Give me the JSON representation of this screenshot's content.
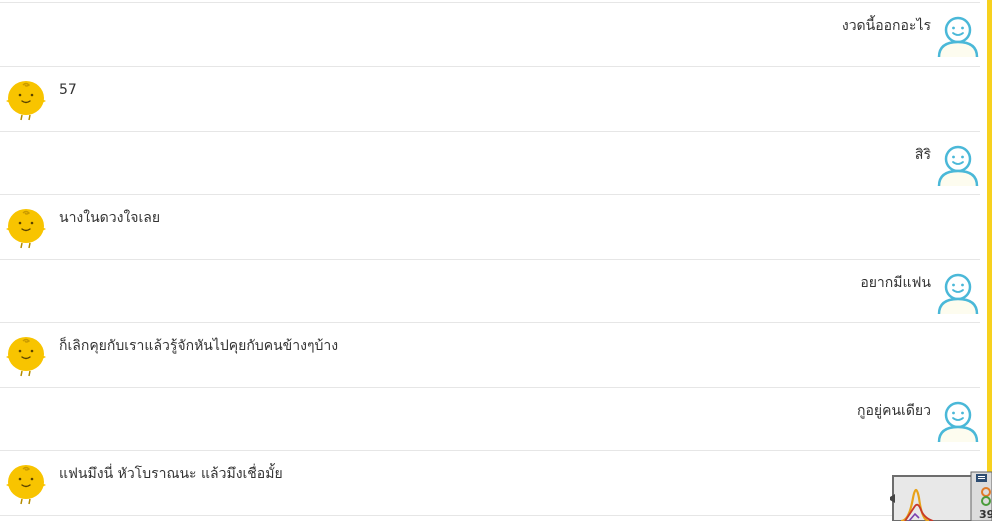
{
  "messages": [
    {
      "role": "user",
      "text": "งวดนี้ออกอะไร"
    },
    {
      "role": "bot",
      "text": "57"
    },
    {
      "role": "user",
      "text": "สิริ"
    },
    {
      "role": "bot",
      "text": "นางในดวงใจเลย"
    },
    {
      "role": "user",
      "text": "อยากมีแฟน"
    },
    {
      "role": "bot",
      "text": "ก็เลิกคุยกับเราแล้วรู้จักหันไปคุยกับคนข้างๆบ้าง"
    },
    {
      "role": "user",
      "text": "กูอยู่คนเดียว"
    },
    {
      "role": "bot",
      "text": "แฟนมึงนี่ หัวโบราณนะ แล้วมึงเชื่อมั้ย"
    }
  ],
  "widget": {
    "badge_text": "39"
  },
  "colors": {
    "scrollbar": "#f7d11e",
    "user_avatar_stroke": "#4ab8d8",
    "bot_avatar_fill": "#f8c400"
  }
}
